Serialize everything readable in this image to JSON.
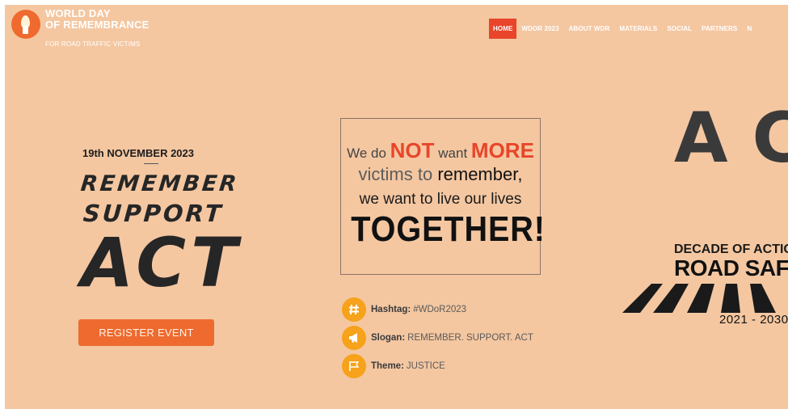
{
  "logo": {
    "line1": "WORLD DAY",
    "line2": "OF REMEMBRANCE",
    "line3": "FOR ROAD TRAFFIC VICTIMS",
    "icon": "candle-flame-icon"
  },
  "nav": {
    "items": [
      "HOME",
      "WDOR 2023",
      "ABOUT WDR",
      "MATERIALS",
      "SOCIAL",
      "PARTNERS",
      "N"
    ],
    "active": "HOME"
  },
  "hero_left": {
    "date": "19th NOVEMBER 2023",
    "word1": "REMEMBER",
    "word2": "SUPPORT",
    "word3": "ACT",
    "register_label": "REGISTER EVENT"
  },
  "quote": {
    "p1": "We do ",
    "not": "NOT",
    "p2": " want ",
    "more": "MORE",
    "victims_to": "victims to ",
    "remember": "remember,",
    "line3": "we want to live our lives",
    "together": "TOGETHER!"
  },
  "info": [
    {
      "icon": "hashtag-icon",
      "glyph": "#",
      "label": "Hashtag:",
      "value": "#WDoR2023"
    },
    {
      "icon": "megaphone-icon",
      "glyph": "📣",
      "label": "Slogan:",
      "value": "REMEMBER. SUPPORT. ACT"
    },
    {
      "icon": "flag-icon",
      "glyph": "⚑",
      "label": "Theme:",
      "value": "JUSTICE"
    }
  ],
  "hero_right": {
    "big_letters": "AC",
    "decade": "DECADE OF ACTIO",
    "road_safety": "ROAD SAF",
    "years": "2021 - 2030"
  },
  "colors": {
    "background": "#f4c7a1",
    "accent": "#ee6a2f",
    "nav_active": "#e8452a",
    "icon_circle": "#f6a21a"
  }
}
